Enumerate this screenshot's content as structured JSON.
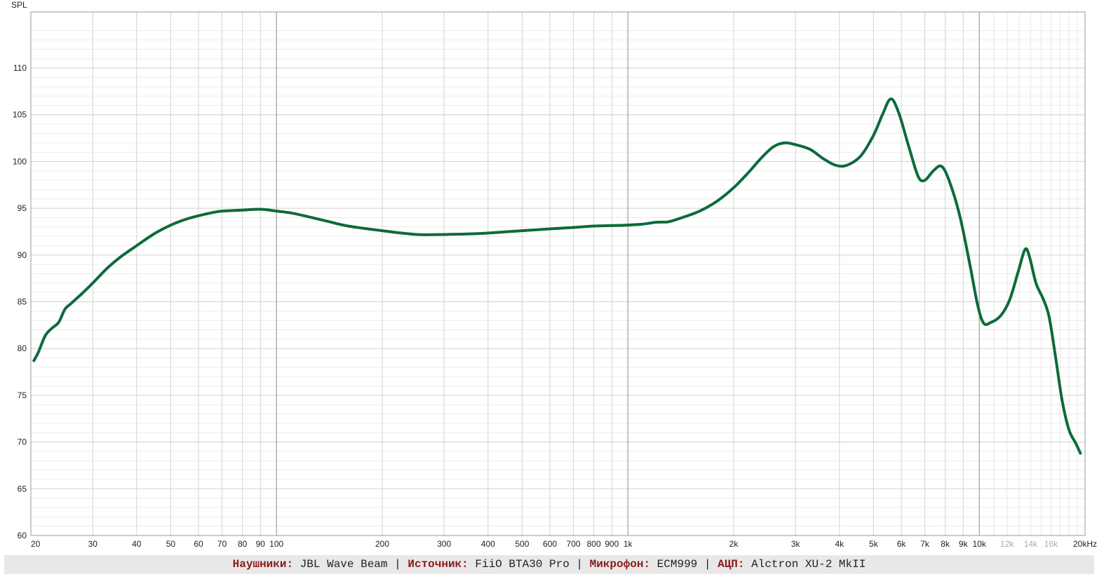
{
  "chart_data": {
    "type": "line",
    "ylabel": "SPL",
    "xscale": "log",
    "xlim": [
      20,
      20000
    ],
    "ylim": [
      60,
      116
    ],
    "y_ticks": [
      60,
      65,
      70,
      75,
      80,
      85,
      90,
      95,
      100,
      105,
      110
    ],
    "x_ticks": [
      {
        "value": 20,
        "label": "20"
      },
      {
        "value": 30,
        "label": "30"
      },
      {
        "value": 40,
        "label": "40"
      },
      {
        "value": 50,
        "label": "50"
      },
      {
        "value": 60,
        "label": "60"
      },
      {
        "value": 70,
        "label": "70"
      },
      {
        "value": 80,
        "label": "80"
      },
      {
        "value": 90,
        "label": "90"
      },
      {
        "value": 100,
        "label": "100"
      },
      {
        "value": 200,
        "label": "200"
      },
      {
        "value": 300,
        "label": "300"
      },
      {
        "value": 400,
        "label": "400"
      },
      {
        "value": 500,
        "label": "500"
      },
      {
        "value": 600,
        "label": "600"
      },
      {
        "value": 700,
        "label": "700"
      },
      {
        "value": 800,
        "label": "800"
      },
      {
        "value": 900,
        "label": "900"
      },
      {
        "value": 1000,
        "label": "1k"
      },
      {
        "value": 2000,
        "label": "2k"
      },
      {
        "value": 3000,
        "label": "3k"
      },
      {
        "value": 4000,
        "label": "4k"
      },
      {
        "value": 5000,
        "label": "5k"
      },
      {
        "value": 6000,
        "label": "6k"
      },
      {
        "value": 7000,
        "label": "7k"
      },
      {
        "value": 8000,
        "label": "8k"
      },
      {
        "value": 9000,
        "label": "9k"
      },
      {
        "value": 10000,
        "label": "10k"
      },
      {
        "value": 12000,
        "label": "12k",
        "faded": true
      },
      {
        "value": 14000,
        "label": "14k",
        "faded": true
      },
      {
        "value": 16000,
        "label": "16k",
        "faded": true
      },
      {
        "value": 20000,
        "label": "20kHz"
      }
    ],
    "grid": true,
    "series": [
      {
        "color": "#0d6b3a",
        "points": [
          [
            20.4,
            78.7
          ],
          [
            21,
            79.6
          ],
          [
            22,
            81.4
          ],
          [
            23,
            82.2
          ],
          [
            24,
            82.8
          ],
          [
            25,
            84.2
          ],
          [
            26,
            84.8
          ],
          [
            28,
            85.9
          ],
          [
            30,
            87.0
          ],
          [
            33,
            88.6
          ],
          [
            36,
            89.8
          ],
          [
            40,
            91.0
          ],
          [
            45,
            92.3
          ],
          [
            50,
            93.2
          ],
          [
            55,
            93.8
          ],
          [
            60,
            94.2
          ],
          [
            65,
            94.5
          ],
          [
            70,
            94.7
          ],
          [
            80,
            94.8
          ],
          [
            90,
            94.9
          ],
          [
            100,
            94.7
          ],
          [
            110,
            94.5
          ],
          [
            120,
            94.2
          ],
          [
            140,
            93.6
          ],
          [
            160,
            93.1
          ],
          [
            200,
            92.6
          ],
          [
            250,
            92.2
          ],
          [
            300,
            92.2
          ],
          [
            350,
            92.25
          ],
          [
            400,
            92.35
          ],
          [
            500,
            92.6
          ],
          [
            600,
            92.8
          ],
          [
            700,
            92.95
          ],
          [
            800,
            93.1
          ],
          [
            900,
            93.15
          ],
          [
            1000,
            93.2
          ],
          [
            1100,
            93.3
          ],
          [
            1200,
            93.5
          ],
          [
            1300,
            93.55
          ],
          [
            1400,
            93.9
          ],
          [
            1600,
            94.7
          ],
          [
            1800,
            95.8
          ],
          [
            2000,
            97.2
          ],
          [
            2200,
            98.8
          ],
          [
            2400,
            100.4
          ],
          [
            2600,
            101.6
          ],
          [
            2800,
            102.0
          ],
          [
            3000,
            101.8
          ],
          [
            3300,
            101.3
          ],
          [
            3600,
            100.3
          ],
          [
            3900,
            99.6
          ],
          [
            4200,
            99.6
          ],
          [
            4600,
            100.6
          ],
          [
            5000,
            102.8
          ],
          [
            5300,
            105.0
          ],
          [
            5600,
            106.7
          ],
          [
            5900,
            105.2
          ],
          [
            6300,
            101.6
          ],
          [
            6700,
            98.4
          ],
          [
            7000,
            98.0
          ],
          [
            7400,
            99.0
          ],
          [
            7800,
            99.5
          ],
          [
            8200,
            98.0
          ],
          [
            8800,
            94.2
          ],
          [
            9400,
            89.0
          ],
          [
            9900,
            84.6
          ],
          [
            10300,
            82.7
          ],
          [
            10800,
            82.8
          ],
          [
            11500,
            83.5
          ],
          [
            12200,
            85.2
          ],
          [
            12900,
            88.2
          ],
          [
            13500,
            90.6
          ],
          [
            13900,
            89.8
          ],
          [
            14500,
            87.0
          ],
          [
            15200,
            85.3
          ],
          [
            15800,
            83.4
          ],
          [
            16500,
            79.0
          ],
          [
            17200,
            74.5
          ],
          [
            18000,
            71.3
          ],
          [
            18800,
            69.9
          ],
          [
            19400,
            68.8
          ]
        ]
      }
    ]
  },
  "caption": [
    {
      "key": "Наушники:",
      "value": "JBL Wave Beam"
    },
    {
      "key": "Источник:",
      "value": "FiiO BTA30 Pro"
    },
    {
      "key": "Микрофон:",
      "value": "ECM999"
    },
    {
      "key": "АЦП:",
      "value": "Alctron XU-2 MkII"
    }
  ],
  "caption_separator": "|"
}
